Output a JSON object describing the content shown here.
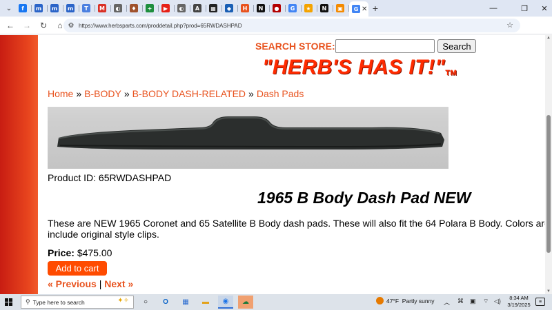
{
  "browser": {
    "url": "https://www.herbsparts.com/proddetail.php?prod=65RWDASHPAD",
    "tabs": [
      {
        "icon": "facebook-icon",
        "color": "#1877f2",
        "glyph": "f"
      },
      {
        "icon": "site-icon",
        "color": "#2b64c8",
        "glyph": "m"
      },
      {
        "icon": "site-icon",
        "color": "#2b64c8",
        "glyph": "m"
      },
      {
        "icon": "site-icon",
        "color": "#2b64c8",
        "glyph": "m"
      },
      {
        "icon": "translate-icon",
        "color": "#4a7fe0",
        "glyph": "T"
      },
      {
        "icon": "gmail-icon",
        "color": "#d93025",
        "glyph": "M"
      },
      {
        "icon": "globe-icon",
        "color": "#666666",
        "glyph": "◐"
      },
      {
        "icon": "badge-icon",
        "color": "#a0522d",
        "glyph": "♦"
      },
      {
        "icon": "sheets-icon",
        "color": "#1e8e3e",
        "glyph": "+"
      },
      {
        "icon": "youtube-icon",
        "color": "#e62117",
        "glyph": "▶"
      },
      {
        "icon": "globe-icon",
        "color": "#666666",
        "glyph": "◐"
      },
      {
        "icon": "site-icon",
        "color": "#444444",
        "glyph": "A"
      },
      {
        "icon": "site-icon",
        "color": "#222222",
        "glyph": "▦"
      },
      {
        "icon": "site-icon",
        "color": "#1a5fb4",
        "glyph": "◆"
      },
      {
        "icon": "site-icon",
        "color": "#e8531f",
        "glyph": "H"
      },
      {
        "icon": "site-icon",
        "color": "#111111",
        "glyph": "N"
      },
      {
        "icon": "site-icon",
        "color": "#b30000",
        "glyph": "●"
      },
      {
        "icon": "google-icon",
        "color": "#4285f4",
        "glyph": "G"
      },
      {
        "icon": "site-icon",
        "color": "#f4a300",
        "glyph": "★"
      },
      {
        "icon": "site-icon",
        "color": "#111111",
        "glyph": "N"
      },
      {
        "icon": "site-icon",
        "color": "#f48a00",
        "glyph": "▣"
      },
      {
        "icon": "google-icon",
        "color": "#4285f4",
        "glyph": "G"
      }
    ],
    "active_tab_index": 21
  },
  "store": {
    "search_label": "SEARCH STORE:",
    "search_value": "",
    "search_button": "Search",
    "logo_text": "\"HERB'S HAS IT!\"",
    "logo_tm": "TM"
  },
  "breadcrumb": {
    "items": [
      "Home",
      "B-BODY",
      "B-BODY DASH-RELATED",
      "Dash Pads"
    ],
    "separator": "»"
  },
  "product": {
    "id_label": "Product ID: 65RWDASHPAD",
    "title": "1965 B Body Dash Pad NEW",
    "description_line1": "These are NEW 1965 Coronet and 65 Satellite B Body dash pads. These will also fit the 64 Polara B Body. Colors are av",
    "description_line2": "include original style clips.",
    "price_label": "Price:",
    "price_value": "$475.00",
    "cart_button": "Add to cart",
    "prev_link": "« Previous",
    "next_link": "Next »",
    "pager_sep": "|"
  },
  "taskbar": {
    "search_placeholder": "Type here to search",
    "temperature": "47°F",
    "weather": "Partly sunny",
    "time": "8:34 AM",
    "date": "3/19/2025"
  }
}
